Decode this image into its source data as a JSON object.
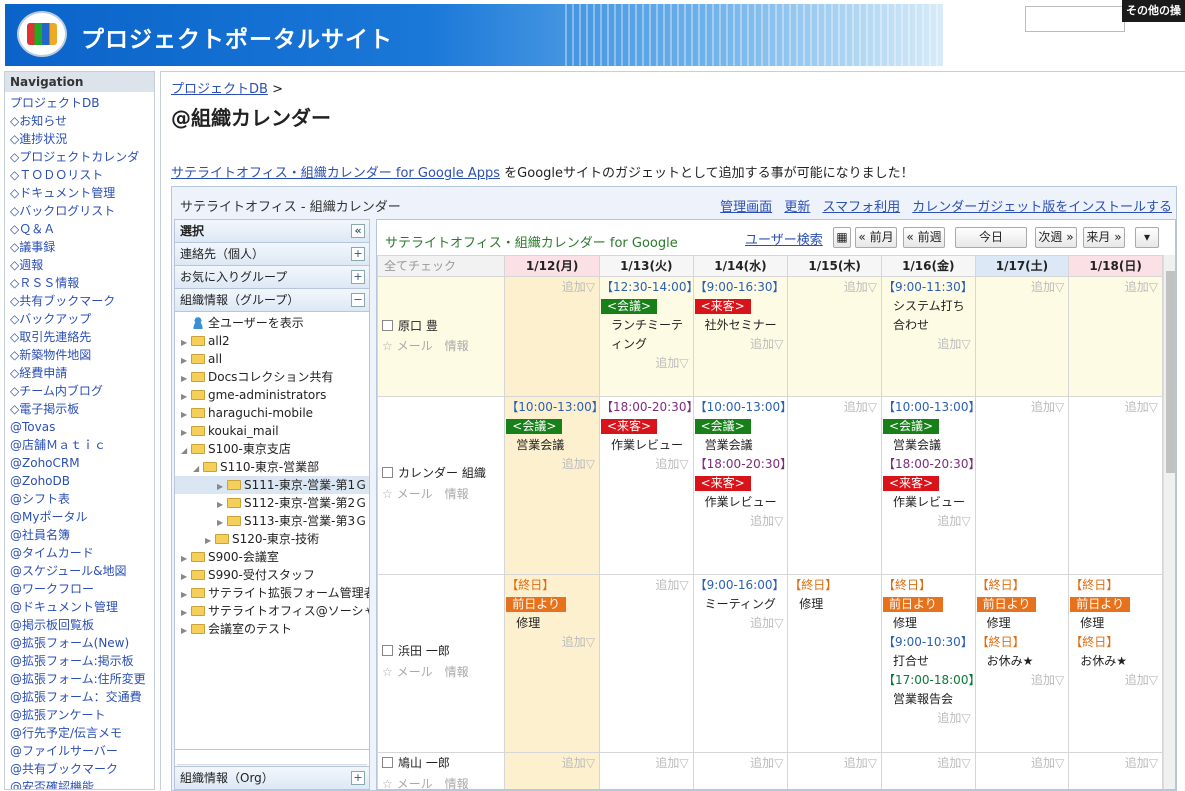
{
  "site": {
    "title": "プロジェクトポータルサイト",
    "other": "その他の操"
  },
  "nav": {
    "heading": "Navigation",
    "items": [
      "プロジェクトDB",
      "◇お知らせ",
      "◇進捗状況",
      "◇プロジェクトカレンダ",
      "◇ＴＯＤＯリスト",
      "◇ドキュメント管理",
      "◇バックログリスト",
      "◇Ｑ＆Ａ",
      "◇議事録",
      "◇週報",
      "◇ＲＳＳ情報",
      "◇共有ブックマーク",
      "◇バックアップ",
      "◇取引先連絡先",
      "◇新築物件地図",
      "◇経費申請",
      "◇チーム内ブログ",
      "◇電子掲示板",
      "@Tovas",
      "@店舗Ｍａｔｉｃ",
      "@ZohoCRM",
      "@ZohoDB",
      "@シフト表",
      "@Myポータル",
      "@社員名簿",
      "@タイムカード",
      "@スケジュール&地図",
      "@ワークフロー",
      "@ドキュメント管理",
      "@掲示板回覧板",
      "@拡張フォーム(New)",
      "@拡張フォーム:掲示板",
      "@拡張フォーム:住所変更",
      "@拡張フォーム：交通費",
      "@拡張アンケート",
      "@行先予定/伝言メモ",
      "@ファイルサーバー",
      "@共有ブックマーク",
      "@安否確認機能"
    ]
  },
  "crumb": {
    "link": "プロジェクトDB",
    "sep": " >"
  },
  "page_title": "@組織カレンダー",
  "notice": {
    "link": "サテライトオフィス・組織カレンダー for Google Apps",
    "text": " をGoogleサイトのガジェットとして追加する事が可能になりました！"
  },
  "gadget": {
    "title": "サテライトオフィス - 組織カレンダー",
    "links": [
      "管理画面",
      "更新",
      "スマフォ利用",
      "カレンダーガジェット版をインストールする"
    ]
  },
  "side": {
    "select": "選択",
    "collapse": "«",
    "contacts": "連絡先（個人）",
    "favorites": "お気に入りグループ",
    "org_group": "組織情報（グループ）",
    "org": "組織情報（Org）",
    "plus": "+",
    "minus": "−",
    "tree": [
      "全ユーザーを表示",
      "all2",
      "all",
      "Docsコレクション共有",
      "gme-administrators",
      "haraguchi-mobile",
      "koukai_mail",
      "S100-東京支店",
      "S110-東京-営業部",
      "S111-東京-営業-第1Ｇ",
      "S112-東京-営業-第2Ｇ",
      "S113-東京-営業-第3Ｇ",
      "S120-東京-技術",
      "S900-会議室",
      "S990-受付スタッフ",
      "サテライト拡張フォーム管理者",
      "サテライトオフィス@ソーシャ",
      "会議室のテスト"
    ]
  },
  "cal": {
    "title": "サテライトオフィス・組織カレンダー for Google",
    "user_search": "ユーザー検索",
    "prev_month": "« 前月",
    "prev_week": "« 前週",
    "today": "今日",
    "next_week": "次週 »",
    "next_month": "来月 »",
    "more": "▾",
    "check_all": "全てチェック",
    "days": [
      "1/12(月)",
      "1/13(火)",
      "1/14(水)",
      "1/15(木)",
      "1/16(金)",
      "1/17(土)",
      "1/18(日)"
    ],
    "add": "追加▽",
    "mail": "メール",
    "info": "情報",
    "star": "☆",
    "users": [
      "原口 豊",
      "カレンダー 組織",
      "浜田 一郎",
      "鳩山 一郎"
    ],
    "tags": {
      "meeting": "<会議>",
      "visitor": "<来客>",
      "from_prev": "前日より"
    },
    "ev": {
      "u1d2_time": "【12:30-14:00】",
      "u1d2_title": "ランチミーティング",
      "u1d3_time": "【9:00-16:30】",
      "u1d3_title": "社外セミナー",
      "u1d5_time": "【9:00-11:30】",
      "u1d5_title": "システム打ち合わせ",
      "u2d1_time": "【10:00-13:00】",
      "u2d1_title": "営業会議",
      "u2d2_time": "【18:00-20:30】",
      "u2d2_title": "作業レビュー",
      "u2d3_time1": "【10:00-13:00】",
      "u2d3_title1": "営業会議",
      "u2d3_time2": "【18:00-20:30】",
      "u2d3_title2": "作業レビュー",
      "u2d5_time1": "【10:00-13:00】",
      "u2d5_title1": "営業会議",
      "u2d5_time2": "【18:00-20:30】",
      "u2d5_title2": "作業レビュー",
      "allday": "【終日】",
      "repair": "修理",
      "rest": "お休み★",
      "u3d3_time": "【9:00-16:00】",
      "u3d3_title": "ミーティング",
      "u3d5_time1": "【9:00-10:30】",
      "u3d5_title1": "打合せ",
      "u3d5_time2": "【17:00-18:00】",
      "u3d5_title2": "営業報告会"
    }
  }
}
